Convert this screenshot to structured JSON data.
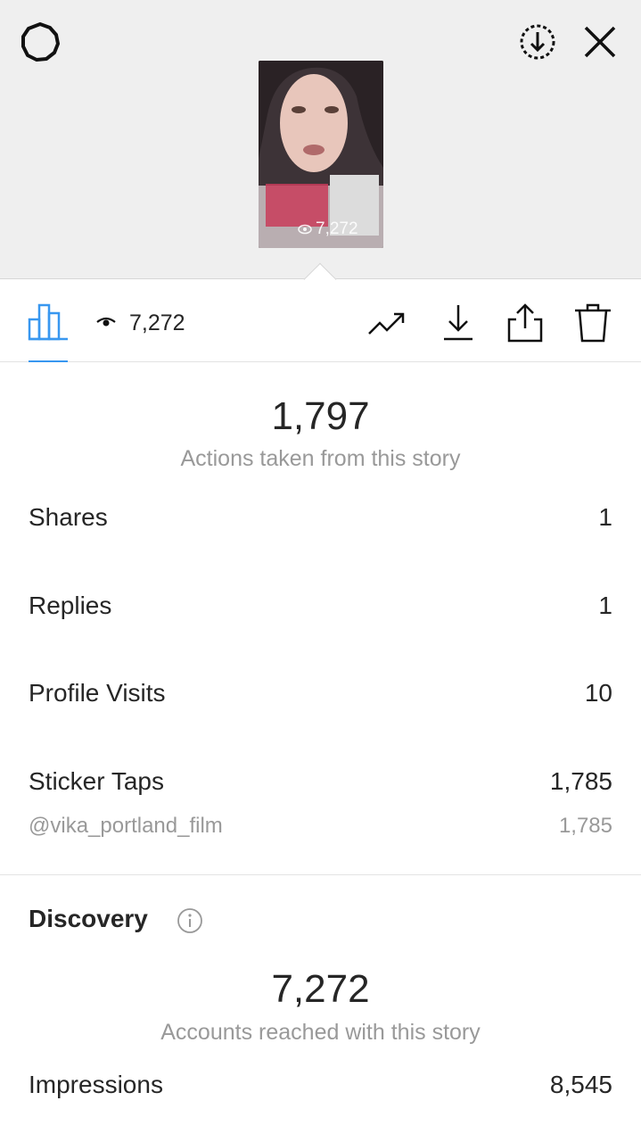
{
  "header": {
    "settings_icon": "settings-gear-icon",
    "download_circle_icon": "download-circle-icon",
    "close_icon": "close-icon"
  },
  "thumbnail": {
    "view_count": "7,272"
  },
  "tabbar": {
    "insights_icon": "bar-chart-icon",
    "viewer_count": "7,272",
    "accent_color": "#3897f0",
    "actions": [
      "trend-icon",
      "download-icon",
      "share-icon",
      "trash-icon"
    ]
  },
  "interactions": {
    "total": "1,797",
    "caption": "Actions taken from this story",
    "rows": [
      {
        "label": "Shares",
        "value": "1"
      },
      {
        "label": "Replies",
        "value": "1"
      },
      {
        "label": "Profile Visits",
        "value": "10"
      },
      {
        "label": "Sticker Taps",
        "value": "1,785"
      }
    ],
    "sticker_detail": {
      "label": "@vika_portland_film",
      "value": "1,785"
    }
  },
  "discovery": {
    "title": "Discovery",
    "total": "7,272",
    "caption": "Accounts reached with this story",
    "rows": [
      {
        "label": "Impressions",
        "value": "8,545"
      }
    ]
  }
}
